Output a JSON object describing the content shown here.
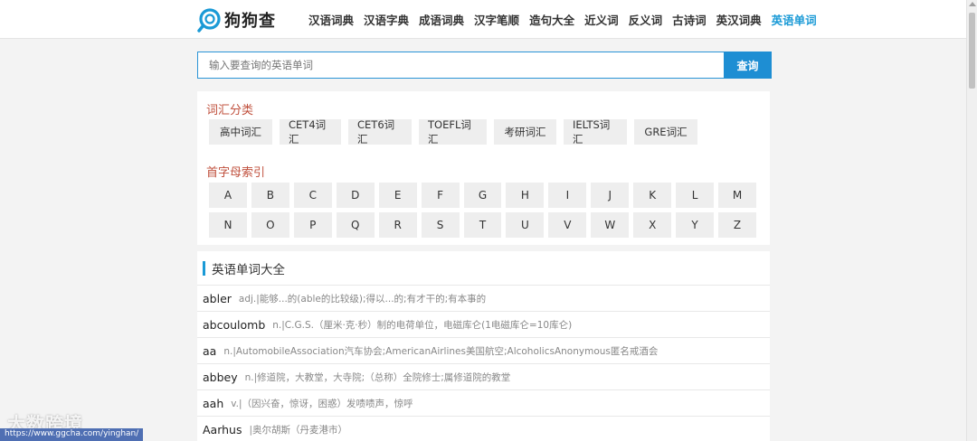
{
  "header": {
    "logo_text": "狗狗查",
    "nav": [
      {
        "label": "汉语词典",
        "active": false
      },
      {
        "label": "汉语字典",
        "active": false
      },
      {
        "label": "成语词典",
        "active": false
      },
      {
        "label": "汉字笔顺",
        "active": false
      },
      {
        "label": "造句大全",
        "active": false
      },
      {
        "label": "近义词",
        "active": false
      },
      {
        "label": "反义词",
        "active": false
      },
      {
        "label": "古诗词",
        "active": false
      },
      {
        "label": "英汉词典",
        "active": false
      },
      {
        "label": "英语单词",
        "active": true
      }
    ]
  },
  "search": {
    "placeholder": "输入要查询的英语单词",
    "button_label": "查询"
  },
  "categories": {
    "title": "词汇分类",
    "items": [
      "高中词汇",
      "CET4词汇",
      "CET6词汇",
      "TOEFL词汇",
      "考研词汇",
      "IELTS词汇",
      "GRE词汇"
    ]
  },
  "letters": {
    "title": "首字母索引",
    "rows": [
      [
        "A",
        "B",
        "C",
        "D",
        "E",
        "F",
        "G",
        "H",
        "I",
        "J",
        "K",
        "L",
        "M"
      ],
      [
        "N",
        "O",
        "P",
        "Q",
        "R",
        "S",
        "T",
        "U",
        "V",
        "W",
        "X",
        "Y",
        "Z"
      ]
    ]
  },
  "word_list": {
    "title": "英语单词大全",
    "items": [
      {
        "word": "abler",
        "def": "adj.|能够...的(able的比较级);得以...的;有才干的;有本事的"
      },
      {
        "word": "abcoulomb",
        "def": "n.|C.G.S.（厘米·克·秒）制的电荷单位，电磁库仑(1电磁库仑=10库仑)"
      },
      {
        "word": "aa",
        "def": "n.|AutomobileAssociation汽车协会;AmericanAirlines美国航空;AlcoholicsAnonymous匿名戒酒会"
      },
      {
        "word": "abbey",
        "def": "n.|修道院，大教堂，大寺院;（总称）全院修士;属修道院的教堂"
      },
      {
        "word": "aah",
        "def": "v.|（因兴奋，惊讶，困惑）发啧啧声，惊呼"
      },
      {
        "word": "Aarhus",
        "def": "|奥尔胡斯（丹麦港市）"
      }
    ]
  },
  "watermark": {
    "logo_text": "大数跨境",
    "url": "https://www.ggcha.com/yinghan/"
  },
  "colors": {
    "accent": "#1a9ad6",
    "search_button": "#1e8ed3",
    "section_title": "#c0503d"
  }
}
